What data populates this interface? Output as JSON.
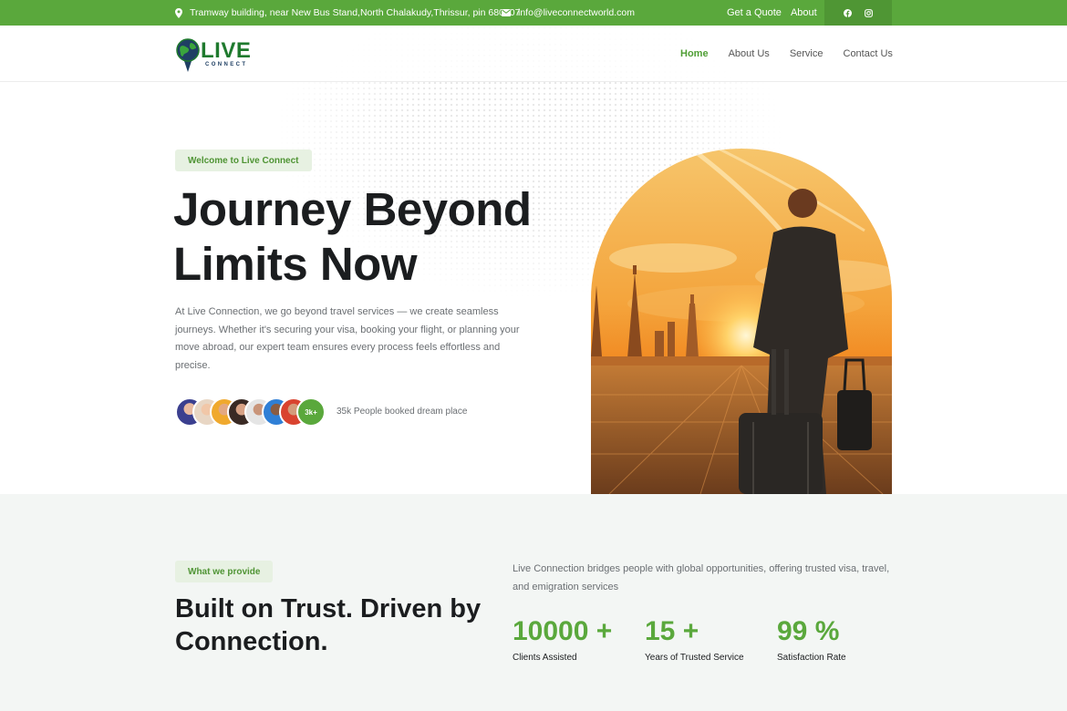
{
  "topbar": {
    "address": "Tramway building, near New Bus Stand,North Chalakudy,Thrissur, pin 680307",
    "email": "info@liveconnectworld.com",
    "links": [
      "Get a Quote",
      "About"
    ],
    "social_icons": [
      "facebook-icon",
      "instagram-icon"
    ]
  },
  "logo": {
    "word": "LIVE",
    "sub": "CONNECT"
  },
  "nav": [
    "Home",
    "About Us",
    "Service",
    "Contact Us"
  ],
  "hero": {
    "tag": "Welcome to Live Connect",
    "title_line1": "Journey Beyond",
    "title_line2": "Limits Now",
    "text": "At Live Connection, we go beyond travel services — we create seamless journeys. Whether it's securing your visa, booking your flight, or planning your move abroad, our expert team ensures every process feels effortless and precise.",
    "avatar_badge": "3k+",
    "booked": "35k People booked dream place"
  },
  "section2": {
    "tag": "What we provide",
    "title": "Built on Trust. Driven by Connection.",
    "text": "Live Connection bridges people with global opportunities, offering trusted visa, travel, and emigration services",
    "stats": [
      {
        "value": "10000 +",
        "label": "Clients Assisted"
      },
      {
        "value": "15 +",
        "label": "Years of Trusted Service"
      },
      {
        "value": "99 %",
        "label": "Satisfaction Rate"
      }
    ]
  },
  "colors": {
    "brand_green": "#5aa83c",
    "dark_text": "#1b1d1f",
    "muted_text": "#6b6f73"
  }
}
